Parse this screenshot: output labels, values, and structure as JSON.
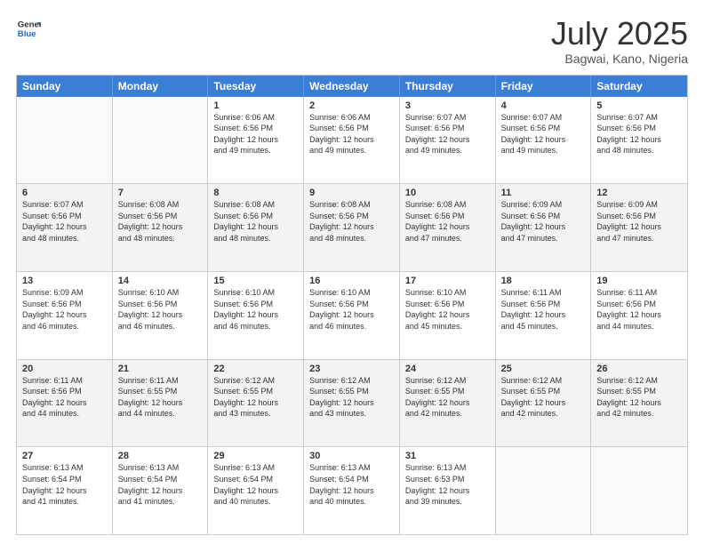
{
  "header": {
    "logo_line1": "General",
    "logo_line2": "Blue",
    "month": "July 2025",
    "location": "Bagwai, Kano, Nigeria"
  },
  "days_of_week": [
    "Sunday",
    "Monday",
    "Tuesday",
    "Wednesday",
    "Thursday",
    "Friday",
    "Saturday"
  ],
  "weeks": [
    [
      {
        "day": "",
        "info": "",
        "empty": true
      },
      {
        "day": "",
        "info": "",
        "empty": true
      },
      {
        "day": "1",
        "info": "Sunrise: 6:06 AM\nSunset: 6:56 PM\nDaylight: 12 hours\nand 49 minutes."
      },
      {
        "day": "2",
        "info": "Sunrise: 6:06 AM\nSunset: 6:56 PM\nDaylight: 12 hours\nand 49 minutes."
      },
      {
        "day": "3",
        "info": "Sunrise: 6:07 AM\nSunset: 6:56 PM\nDaylight: 12 hours\nand 49 minutes."
      },
      {
        "day": "4",
        "info": "Sunrise: 6:07 AM\nSunset: 6:56 PM\nDaylight: 12 hours\nand 49 minutes."
      },
      {
        "day": "5",
        "info": "Sunrise: 6:07 AM\nSunset: 6:56 PM\nDaylight: 12 hours\nand 48 minutes."
      }
    ],
    [
      {
        "day": "6",
        "info": "Sunrise: 6:07 AM\nSunset: 6:56 PM\nDaylight: 12 hours\nand 48 minutes."
      },
      {
        "day": "7",
        "info": "Sunrise: 6:08 AM\nSunset: 6:56 PM\nDaylight: 12 hours\nand 48 minutes."
      },
      {
        "day": "8",
        "info": "Sunrise: 6:08 AM\nSunset: 6:56 PM\nDaylight: 12 hours\nand 48 minutes."
      },
      {
        "day": "9",
        "info": "Sunrise: 6:08 AM\nSunset: 6:56 PM\nDaylight: 12 hours\nand 48 minutes."
      },
      {
        "day": "10",
        "info": "Sunrise: 6:08 AM\nSunset: 6:56 PM\nDaylight: 12 hours\nand 47 minutes."
      },
      {
        "day": "11",
        "info": "Sunrise: 6:09 AM\nSunset: 6:56 PM\nDaylight: 12 hours\nand 47 minutes."
      },
      {
        "day": "12",
        "info": "Sunrise: 6:09 AM\nSunset: 6:56 PM\nDaylight: 12 hours\nand 47 minutes."
      }
    ],
    [
      {
        "day": "13",
        "info": "Sunrise: 6:09 AM\nSunset: 6:56 PM\nDaylight: 12 hours\nand 46 minutes."
      },
      {
        "day": "14",
        "info": "Sunrise: 6:10 AM\nSunset: 6:56 PM\nDaylight: 12 hours\nand 46 minutes."
      },
      {
        "day": "15",
        "info": "Sunrise: 6:10 AM\nSunset: 6:56 PM\nDaylight: 12 hours\nand 46 minutes."
      },
      {
        "day": "16",
        "info": "Sunrise: 6:10 AM\nSunset: 6:56 PM\nDaylight: 12 hours\nand 46 minutes."
      },
      {
        "day": "17",
        "info": "Sunrise: 6:10 AM\nSunset: 6:56 PM\nDaylight: 12 hours\nand 45 minutes."
      },
      {
        "day": "18",
        "info": "Sunrise: 6:11 AM\nSunset: 6:56 PM\nDaylight: 12 hours\nand 45 minutes."
      },
      {
        "day": "19",
        "info": "Sunrise: 6:11 AM\nSunset: 6:56 PM\nDaylight: 12 hours\nand 44 minutes."
      }
    ],
    [
      {
        "day": "20",
        "info": "Sunrise: 6:11 AM\nSunset: 6:56 PM\nDaylight: 12 hours\nand 44 minutes."
      },
      {
        "day": "21",
        "info": "Sunrise: 6:11 AM\nSunset: 6:55 PM\nDaylight: 12 hours\nand 44 minutes."
      },
      {
        "day": "22",
        "info": "Sunrise: 6:12 AM\nSunset: 6:55 PM\nDaylight: 12 hours\nand 43 minutes."
      },
      {
        "day": "23",
        "info": "Sunrise: 6:12 AM\nSunset: 6:55 PM\nDaylight: 12 hours\nand 43 minutes."
      },
      {
        "day": "24",
        "info": "Sunrise: 6:12 AM\nSunset: 6:55 PM\nDaylight: 12 hours\nand 42 minutes."
      },
      {
        "day": "25",
        "info": "Sunrise: 6:12 AM\nSunset: 6:55 PM\nDaylight: 12 hours\nand 42 minutes."
      },
      {
        "day": "26",
        "info": "Sunrise: 6:12 AM\nSunset: 6:55 PM\nDaylight: 12 hours\nand 42 minutes."
      }
    ],
    [
      {
        "day": "27",
        "info": "Sunrise: 6:13 AM\nSunset: 6:54 PM\nDaylight: 12 hours\nand 41 minutes."
      },
      {
        "day": "28",
        "info": "Sunrise: 6:13 AM\nSunset: 6:54 PM\nDaylight: 12 hours\nand 41 minutes."
      },
      {
        "day": "29",
        "info": "Sunrise: 6:13 AM\nSunset: 6:54 PM\nDaylight: 12 hours\nand 40 minutes."
      },
      {
        "day": "30",
        "info": "Sunrise: 6:13 AM\nSunset: 6:54 PM\nDaylight: 12 hours\nand 40 minutes."
      },
      {
        "day": "31",
        "info": "Sunrise: 6:13 AM\nSunset: 6:53 PM\nDaylight: 12 hours\nand 39 minutes."
      },
      {
        "day": "",
        "info": "",
        "empty": true
      },
      {
        "day": "",
        "info": "",
        "empty": true
      }
    ]
  ]
}
